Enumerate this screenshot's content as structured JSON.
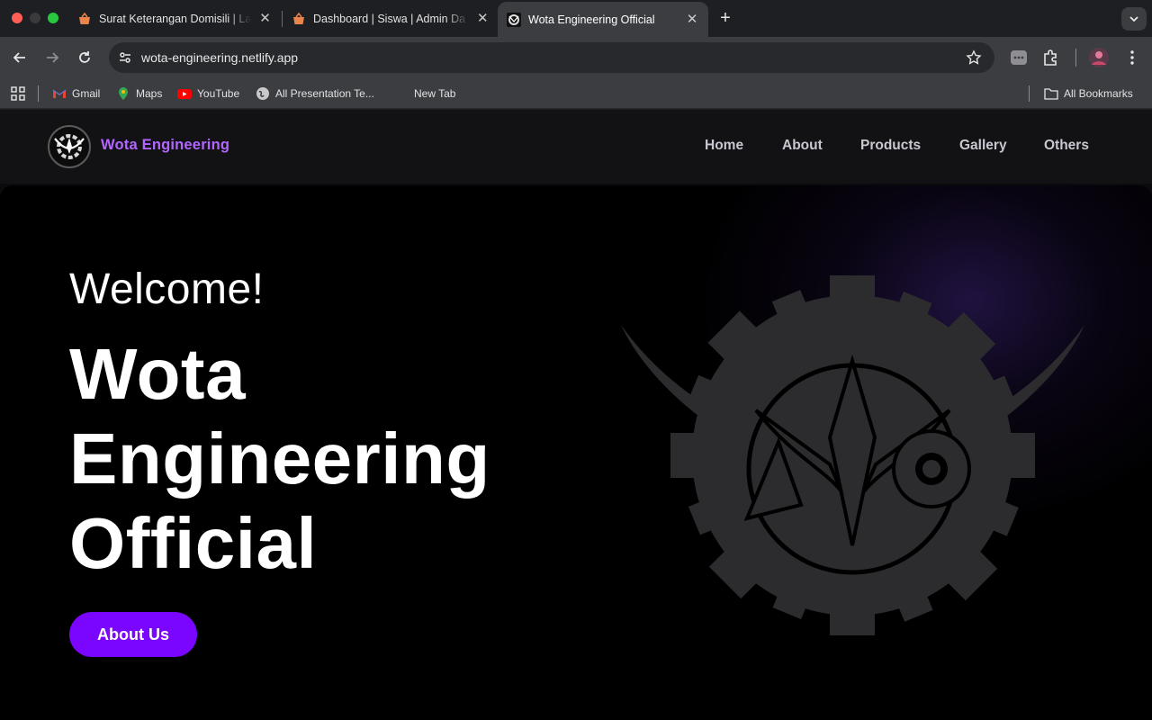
{
  "browser": {
    "tabs": [
      {
        "title": "Surat Keterangan Domisili | La",
        "favicon": "basket-icon"
      },
      {
        "title": "Dashboard | Siswa | Admin Da",
        "favicon": "basket-icon"
      },
      {
        "title": "Wota Engineering Official",
        "favicon": "wota-logo-icon",
        "active": true
      }
    ],
    "url": "wota-engineering.netlify.app",
    "bookmarks": [
      {
        "label": "Gmail",
        "icon": "gmail-icon"
      },
      {
        "label": "Maps",
        "icon": "maps-icon"
      },
      {
        "label": "YouTube",
        "icon": "youtube-icon"
      },
      {
        "label": "All Presentation Te...",
        "icon": "globe-icon"
      },
      {
        "label": "New Tab",
        "icon": "blank-icon"
      }
    ],
    "all_bookmarks": "All Bookmarks"
  },
  "site": {
    "brand": "Wota Engineering",
    "nav": [
      "Home",
      "About",
      "Products",
      "Gallery",
      "Others"
    ],
    "hero": {
      "welcome": "Welcome!",
      "title_lines": [
        "Wota",
        "Engineering",
        "Official"
      ],
      "button": "About Us"
    }
  },
  "colors": {
    "brand": "#b266ff",
    "button": "#7a06ff",
    "hero_bg": "#000000"
  }
}
